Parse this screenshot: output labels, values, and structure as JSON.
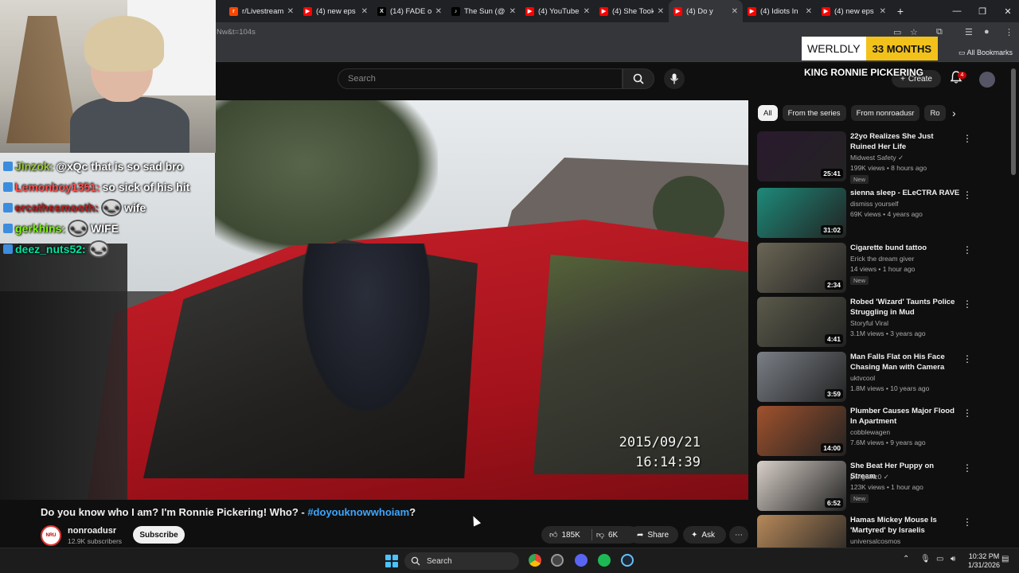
{
  "browser": {
    "tabs": [
      {
        "label": "r/Livestream",
        "color": "#ff4500",
        "glyph": "r"
      },
      {
        "label": "(4) new eps",
        "color": "#ff0000",
        "glyph": "▶"
      },
      {
        "label": "(14) FADE o",
        "color": "#000000",
        "glyph": "X"
      },
      {
        "label": "The Sun (@",
        "color": "#000000",
        "glyph": "♪"
      },
      {
        "label": "(4) YouTube",
        "color": "#ff0000",
        "glyph": "▶"
      },
      {
        "label": "(4) She Took",
        "color": "#ff0000",
        "glyph": "▶"
      },
      {
        "label": "(4) Do y",
        "color": "#ff0000",
        "glyph": "▶"
      },
      {
        "label": "(4) Idiots In",
        "color": "#ff0000",
        "glyph": "▶"
      },
      {
        "label": "(4) new eps",
        "color": "#ff0000",
        "glyph": "▶"
      }
    ],
    "url_fragment": "Nw&t=104s",
    "all_bookmarks": "All Bookmarks"
  },
  "youtube": {
    "search_placeholder": "Search",
    "create_label": "Create",
    "notif_count": "4"
  },
  "overlay": {
    "brand": "WERLDLY",
    "months": "33 MONTHS",
    "king_text": "KING RONNIE PICKERING"
  },
  "chat": [
    {
      "user": "Jinzok:",
      "color": "#9acd32",
      "msg": "@xQc that is so sad bro",
      "emote": false
    },
    {
      "user": "Lemonboy1351:",
      "color": "#ff4d4d",
      "msg": "so sick of his hit",
      "emote": false
    },
    {
      "user": "ercathesmooth:",
      "color": "#b22222",
      "msg": "wife",
      "emote": true
    },
    {
      "user": "gerkhins:",
      "color": "#7cfc00",
      "msg": "WIFE",
      "emote": true
    },
    {
      "user": "deez_nuts52:",
      "color": "#00e5a0",
      "msg": "",
      "emote": true
    }
  ],
  "video": {
    "date_stamp": "2015/09/21",
    "time_stamp": "16:14:39",
    "title": "Do you know who I am? I'm Ronnie Pickering! Who? - ",
    "hashtag": "#doyouknowwhoiam",
    "title_end": "?",
    "channel": "nonroadusr",
    "subscribers": "12.9K subscribers",
    "subscribe_label": "Subscribe",
    "likes": "185K",
    "dislikes": "6K",
    "share_label": "Share",
    "ask_label": "Ask"
  },
  "sidebar": {
    "chips": [
      "All",
      "From the series",
      "From nonroadusr",
      "Ro"
    ],
    "recommendations": [
      {
        "title": "22yo Realizes She Just Ruined Her Life",
        "channel": "Midwest Safety",
        "verified": true,
        "meta": "199K views • 8 hours ago",
        "new": "New",
        "duration": "25:41",
        "thumb": "#2a1a2e"
      },
      {
        "title": "sienna sleep - ELeCTRA RAVE",
        "channel": "dismiss yourself",
        "verified": false,
        "meta": "69K views • 4 years ago",
        "new": "",
        "duration": "31:02",
        "thumb": "#1d8a7a"
      },
      {
        "title": "Cigarette bund tattoo",
        "channel": "Erick the dream giver",
        "verified": false,
        "meta": "14 views • 1 hour ago",
        "new": "New",
        "duration": "2:34",
        "thumb": "#6b6655"
      },
      {
        "title": "Robed 'Wizard' Taunts Police Struggling in Mud",
        "channel": "Storyful Viral",
        "verified": false,
        "meta": "3.1M views • 3 years ago",
        "new": "",
        "duration": "4:41",
        "thumb": "#5b5a4a"
      },
      {
        "title": "Man Falls Flat on His Face Chasing Man with Camera",
        "channel": "uktvcool",
        "verified": false,
        "meta": "1.8M views • 10 years ago",
        "new": "",
        "duration": "3:59",
        "thumb": "#7a7f86"
      },
      {
        "title": "Plumber Causes Major Flood In Apartment",
        "channel": "cobblewagen",
        "verified": false,
        "meta": "7.6M views • 9 years ago",
        "new": "",
        "duration": "14:00",
        "thumb": "#a0522d"
      },
      {
        "title": "She Beat Her Puppy on Stream",
        "channel": "penguinz0",
        "verified": true,
        "meta": "123K views • 1 hour ago",
        "new": "New",
        "duration": "6:52",
        "thumb": "#d8cfc8"
      },
      {
        "title": "Hamas Mickey Mouse Is 'Martyred' by Israelis",
        "channel": "universalcosmos",
        "verified": false,
        "meta": "",
        "new": "",
        "duration": "",
        "thumb": "#b7895a"
      }
    ]
  },
  "taskbar": {
    "search_label": "Search",
    "time": "10:32 PM",
    "date": "1/31/2026"
  }
}
